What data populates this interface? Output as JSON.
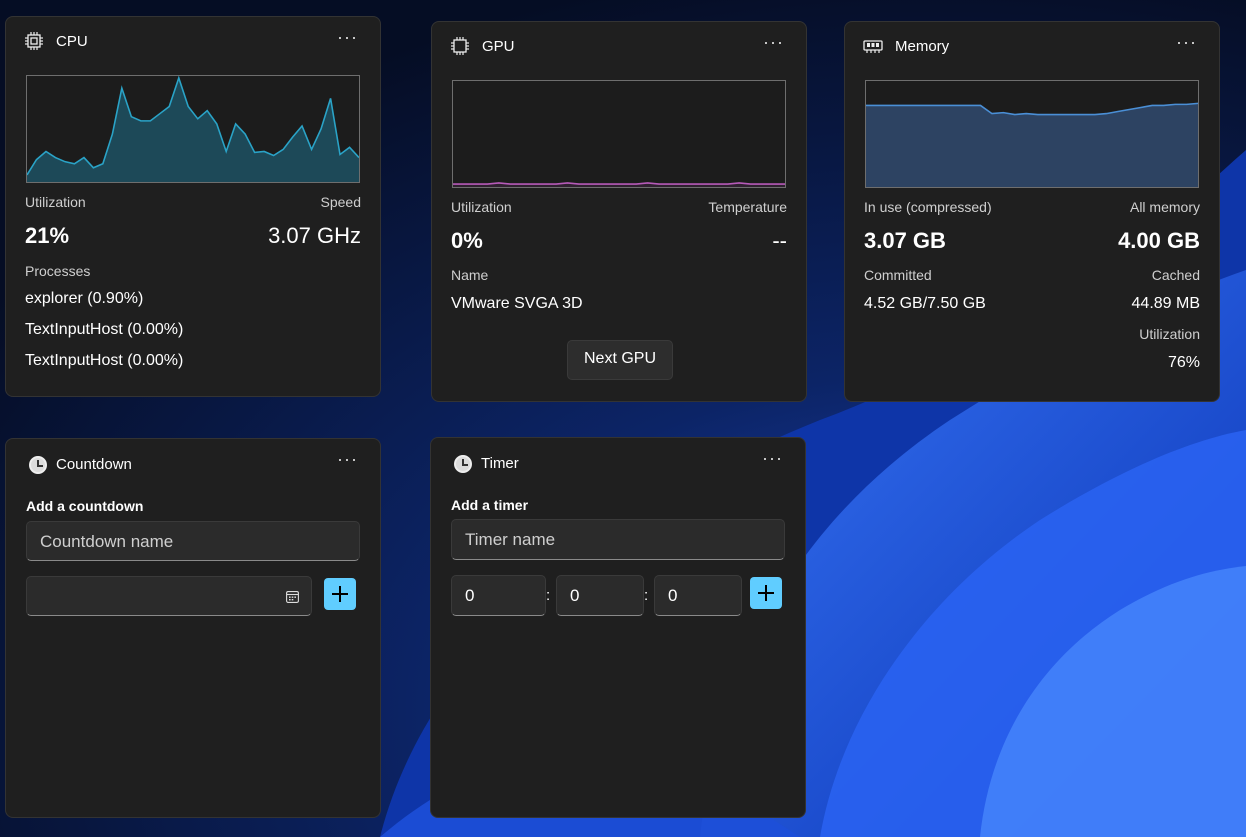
{
  "cpu": {
    "title": "CPU",
    "util_label": "Utilization",
    "speed_label": "Speed",
    "util_value": "21%",
    "speed_value": "3.07 GHz",
    "processes_label": "Processes",
    "processes": [
      "explorer (0.90%)",
      "TextInputHost (0.00%)",
      "TextInputHost (0.00%)"
    ],
    "history": [
      5,
      20,
      28,
      22,
      18,
      16,
      22,
      12,
      16,
      45,
      90,
      62,
      58,
      58,
      65,
      72,
      100,
      72,
      60,
      68,
      55,
      28,
      55,
      45,
      27,
      28,
      24,
      30,
      42,
      53,
      30,
      50,
      80,
      25,
      32,
      22
    ]
  },
  "gpu": {
    "title": "GPU",
    "util_label": "Utilization",
    "temp_label": "Temperature",
    "util_value": "0%",
    "temp_value": "--",
    "name_label": "Name",
    "name_value": "VMware SVGA 3D",
    "next_label": "Next GPU",
    "history": [
      1,
      1,
      1,
      1,
      2,
      1,
      1,
      1,
      1,
      1,
      2,
      1,
      1,
      1,
      1,
      1,
      1,
      2,
      1,
      1,
      1,
      1,
      1,
      1,
      1,
      2,
      1,
      1,
      1,
      1
    ]
  },
  "memory": {
    "title": "Memory",
    "inuse_label": "In use (compressed)",
    "all_label": "All memory",
    "inuse_value": "3.07 GB",
    "all_value": "4.00 GB",
    "committed_label": "Committed",
    "cached_label": "Cached",
    "committed_value": "4.52 GB/7.50 GB",
    "cached_value": "44.89 MB",
    "utilization_label": "Utilization",
    "utilization_value": "76%",
    "history": [
      78,
      78,
      78,
      78,
      78,
      78,
      78,
      78,
      78,
      78,
      78,
      70,
      71,
      69,
      70,
      69,
      69,
      69,
      69,
      69,
      69,
      70,
      72,
      74,
      76,
      78,
      78,
      79,
      79,
      80
    ]
  },
  "countdown": {
    "title": "Countdown",
    "add_label": "Add a countdown",
    "name_placeholder": "Countdown name",
    "date_value": ""
  },
  "timer": {
    "title": "Timer",
    "add_label": "Add a timer",
    "name_placeholder": "Timer name",
    "hours": "0",
    "minutes": "0",
    "seconds": "0",
    "sep": ":"
  },
  "colors": {
    "accent": "#60cdff",
    "cpu_line": "#2aa3c7",
    "gpu_line": "#b65ab8",
    "mem_line": "#4a8fd6"
  },
  "icons": {
    "cpu": "chip-icon",
    "gpu": "chip-icon",
    "memory": "memory-icon",
    "countdown": "clock-icon",
    "timer": "clock-icon",
    "more": "more-icon",
    "calendar": "calendar-icon",
    "add": "plus-icon"
  }
}
